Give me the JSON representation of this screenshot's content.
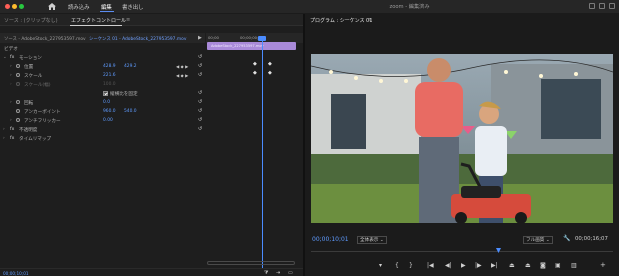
{
  "app": {
    "nav": [
      "読み込み",
      "編集",
      "書き出し"
    ],
    "active_nav": "編集",
    "title": "zoom - 編集済み"
  },
  "effect_controls": {
    "tabs": [
      {
        "label": "ソース : (クリップなし)",
        "active": false
      },
      {
        "label": "エフェクトコントロール",
        "active": true
      }
    ],
    "menu_glyph": "≡",
    "source_label": "ソース - AdobeStock_227953597.mov",
    "sequence_label": "シーケンス 01 - AdobeStock_227953597.mov",
    "play_glyph": "▶",
    "timeline_times": [
      "00;00",
      "00;00;00;08"
    ],
    "clip_name": "AdobeStock_227953597.mov",
    "rows": [
      {
        "label": "ビデオ",
        "type": "section"
      },
      {
        "label": "モーション",
        "type": "group",
        "fx": "fx"
      },
      {
        "label": "位置",
        "v1": "428.9",
        "v2": "429.2",
        "kf": true
      },
      {
        "label": "スケール",
        "v1": "221.6",
        "kf": true
      },
      {
        "label": "スケール(幅)",
        "v1": "100.0",
        "dim": true
      },
      {
        "label": "縦横比を固定",
        "type": "checkbox"
      },
      {
        "label": "回転",
        "v1": "0.0"
      },
      {
        "label": "アンカーポイント",
        "v1": "960.0",
        "v2": "540.0"
      },
      {
        "label": "アンチフリッカー",
        "v1": "0.00"
      },
      {
        "label": "不透明度",
        "type": "group",
        "fx": "fx"
      },
      {
        "label": "タイムリマップ",
        "type": "group",
        "fx": "fx"
      }
    ],
    "reset_glyph": "↺",
    "footer_time": "00;00;10;01"
  },
  "program": {
    "tab_label": "プログラム : シーケンス 01",
    "menu_glyph": "≡",
    "timecode_current": "00;00;10;01",
    "zoom": "全体表示",
    "quality": "フル画質",
    "timecode_total": "00;00;16;07",
    "transport_icons": [
      "marker-icon",
      "in-point-icon",
      "out-point-icon",
      "go-to-in-icon",
      "step-back-icon",
      "play-icon",
      "step-forward-icon",
      "go-to-out-icon",
      "lift-icon",
      "extract-icon",
      "export-frame-icon",
      "comparison-view-icon",
      "multi-cam-icon"
    ],
    "scrub_position_fraction": 0.62
  }
}
